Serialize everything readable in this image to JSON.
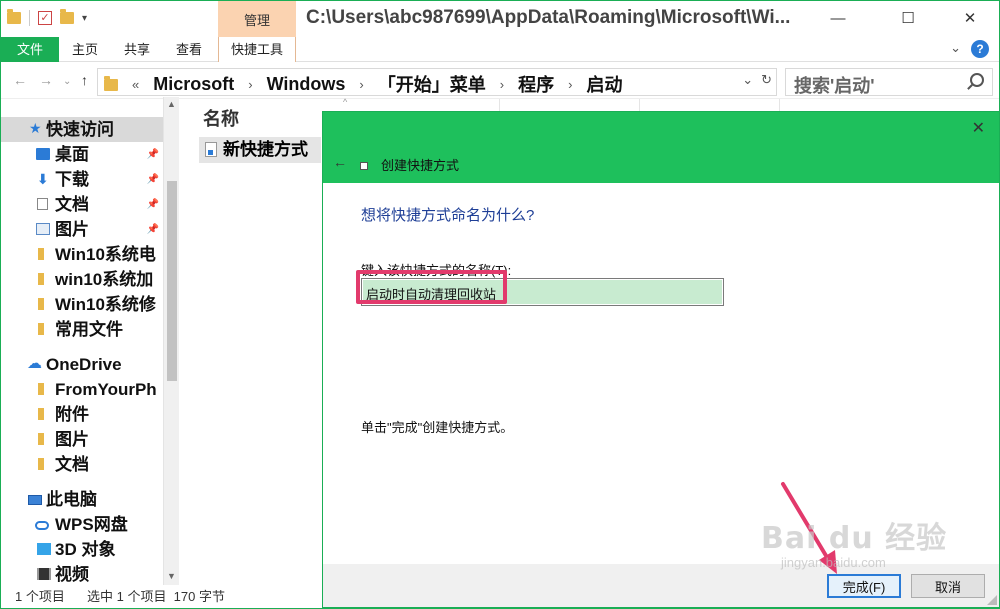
{
  "window": {
    "title_path": "C:\\Users\\abc987699\\AppData\\Roaming\\Microsoft\\Wi...",
    "manage_tab": "管理"
  },
  "ribbon": {
    "tabs": [
      "文件",
      "主页",
      "共享",
      "查看",
      "快捷工具"
    ]
  },
  "address": {
    "crumbs": [
      "Microsoft",
      "Windows",
      "「开始」菜单",
      "程序",
      "启动"
    ],
    "search_placeholder": "搜索'启动'"
  },
  "navpane": {
    "items": [
      {
        "label": "快速访问",
        "icon": "star-icon"
      },
      {
        "label": "桌面",
        "icon": "desktop-icon"
      },
      {
        "label": "下载",
        "icon": "download-icon"
      },
      {
        "label": "文档",
        "icon": "document-icon"
      },
      {
        "label": "图片",
        "icon": "pictures-icon"
      },
      {
        "label": "Win10系统电",
        "icon": "folder-icon"
      },
      {
        "label": "win10系统加",
        "icon": "folder-icon"
      },
      {
        "label": "Win10系统修",
        "icon": "folder-icon"
      },
      {
        "label": "常用文件",
        "icon": "folder-icon"
      },
      {
        "label": "OneDrive",
        "icon": "cloud-icon"
      },
      {
        "label": "FromYourPh",
        "icon": "folder-icon"
      },
      {
        "label": "附件",
        "icon": "folder-icon"
      },
      {
        "label": "图片",
        "icon": "folder-icon"
      },
      {
        "label": "文档",
        "icon": "folder-icon"
      },
      {
        "label": "此电脑",
        "icon": "computer-icon"
      },
      {
        "label": "WPS网盘",
        "icon": "wps-cloud-icon"
      },
      {
        "label": "3D 对象",
        "icon": "3d-objects-icon"
      },
      {
        "label": "视频",
        "icon": "video-icon"
      }
    ]
  },
  "filelist": {
    "column_name": "名称",
    "file_name": "新快捷方式"
  },
  "statusbar": {
    "items": "1 个项目",
    "selected": "选中 1 个项目  170 字节"
  },
  "dialog": {
    "title": "创建快捷方式",
    "heading": "想将快捷方式命名为什么?",
    "label": "键入该快捷方式的名称(T):",
    "input_value": "启动时自动清理回收站",
    "hint": "单击\"完成\"创建快捷方式。",
    "finish_label": "完成(F)",
    "cancel_label": "取消"
  },
  "watermark": {
    "main": "Bai du 经验",
    "sub": "jingyan.baidu.com"
  },
  "colors": {
    "accent_green": "#1ec05c",
    "highlight_pink": "#e23a6c",
    "heading_blue": "#1e3e96"
  }
}
